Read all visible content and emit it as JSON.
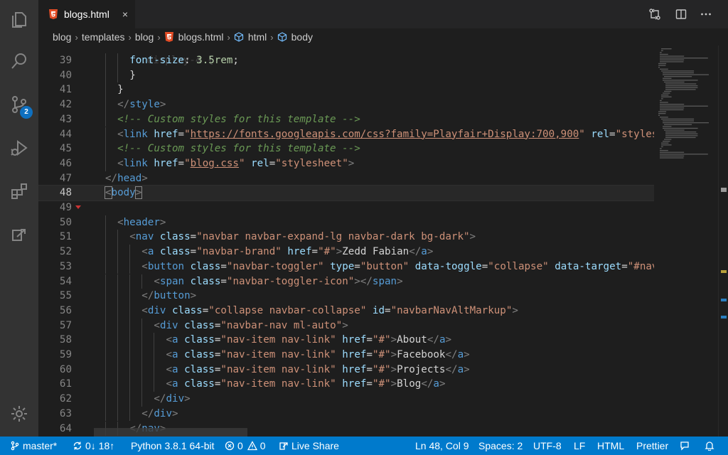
{
  "activity_bar": {
    "items": [
      {
        "name": "explorer-icon"
      },
      {
        "name": "search-icon"
      },
      {
        "name": "source-control-icon",
        "badge": "2"
      },
      {
        "name": "run-debug-icon"
      },
      {
        "name": "extensions-icon"
      },
      {
        "name": "live-share-icon"
      }
    ],
    "settings": {
      "name": "gear-icon"
    }
  },
  "tab": {
    "label": "blogs.html",
    "close": "×",
    "icon": "html5-icon"
  },
  "breadcrumb": [
    "blog",
    "templates",
    "blog",
    "blogs.html",
    "html",
    "body"
  ],
  "editor": {
    "current_line": "48",
    "lines": [
      {
        "n": "39",
        "indent": 2,
        "html": "<span class=\"p\">font-size</span>: <span class=\"num\">3.5rem</span>;"
      },
      {
        "n": "40",
        "indent": 2,
        "html": "}"
      },
      {
        "n": "41",
        "indent": 1,
        "html": "}"
      },
      {
        "n": "42",
        "indent": 1,
        "html": "<span class=\"t\">&lt;/</span><span class=\"n\">style</span><span class=\"t\">&gt;</span>"
      },
      {
        "n": "43",
        "indent": 1,
        "html": "<span class=\"c\">&lt;!-- Custom styles for this template --&gt;</span>"
      },
      {
        "n": "44",
        "indent": 1,
        "html": "<span class=\"t\">&lt;</span><span class=\"n\">link</span> <span class=\"a\">href</span>=<span class=\"s\">\"</span><span class=\"u\">https://fonts.googleapis.com/css?family=Playfair+Display:700,900</span><span class=\"s\">\"</span> <span class=\"a\">rel</span>=<span class=\"s\">\"styleshe</span>"
      },
      {
        "n": "45",
        "indent": 1,
        "html": "<span class=\"c\">&lt;!-- Custom styles for this template --&gt;</span>"
      },
      {
        "n": "46",
        "indent": 1,
        "html": "<span class=\"t\">&lt;</span><span class=\"n\">link</span> <span class=\"a\">href</span>=<span class=\"s\">\"</span><span class=\"u\">blog.css</span><span class=\"s\">\"</span> <span class=\"a\">rel</span>=<span class=\"s\">\"stylesheet\"</span><span class=\"t\">&gt;</span>"
      },
      {
        "n": "47",
        "indent": 0,
        "html": "<span class=\"t\">&lt;/</span><span class=\"n\">head</span><span class=\"t\">&gt;</span>"
      },
      {
        "n": "48",
        "indent": 0,
        "html": "<span class=\"t bracket\">&lt;</span><span class=\"n\">body</span><span class=\"t bracket\">&gt;</span>"
      },
      {
        "n": "49",
        "indent": 0,
        "html": ""
      },
      {
        "n": "50",
        "indent": 1,
        "html": "<span class=\"t\">&lt;</span><span class=\"n\">header</span><span class=\"t\">&gt;</span>"
      },
      {
        "n": "51",
        "indent": 2,
        "html": "<span class=\"t\">&lt;</span><span class=\"n\">nav</span> <span class=\"a\">class</span>=<span class=\"s\">\"navbar navbar-expand-lg navbar-dark bg-dark\"</span><span class=\"t\">&gt;</span>"
      },
      {
        "n": "52",
        "indent": 3,
        "html": "<span class=\"t\">&lt;</span><span class=\"n\">a</span> <span class=\"a\">class</span>=<span class=\"s\">\"navbar-brand\"</span> <span class=\"a\">href</span>=<span class=\"s\">\"#\"</span><span class=\"t\">&gt;</span>Zedd Fabian<span class=\"t\">&lt;/</span><span class=\"n\">a</span><span class=\"t\">&gt;</span>"
      },
      {
        "n": "53",
        "indent": 3,
        "html": "<span class=\"t\">&lt;</span><span class=\"n\">button</span> <span class=\"a\">class</span>=<span class=\"s\">\"navbar-toggler\"</span> <span class=\"a\">type</span>=<span class=\"s\">\"button\"</span> <span class=\"a\">data-toggle</span>=<span class=\"s\">\"collapse\"</span> <span class=\"a\">data-target</span>=<span class=\"s\">\"#navba</span>"
      },
      {
        "n": "54",
        "indent": 4,
        "html": "<span class=\"t\">&lt;</span><span class=\"n\">span</span> <span class=\"a\">class</span>=<span class=\"s\">\"navbar-toggler-icon\"</span><span class=\"t\">&gt;&lt;/</span><span class=\"n\">span</span><span class=\"t\">&gt;</span>"
      },
      {
        "n": "55",
        "indent": 3,
        "html": "<span class=\"t\">&lt;/</span><span class=\"n\">button</span><span class=\"t\">&gt;</span>"
      },
      {
        "n": "56",
        "indent": 3,
        "html": "<span class=\"t\">&lt;</span><span class=\"n\">div</span> <span class=\"a\">class</span>=<span class=\"s\">\"collapse navbar-collapse\"</span> <span class=\"a\">id</span>=<span class=\"s\">\"navbarNavAltMarkup\"</span><span class=\"t\">&gt;</span>"
      },
      {
        "n": "57",
        "indent": 4,
        "html": "<span class=\"t\">&lt;</span><span class=\"n\">div</span> <span class=\"a\">class</span>=<span class=\"s\">\"navbar-nav ml-auto\"</span><span class=\"t\">&gt;</span>"
      },
      {
        "n": "58",
        "indent": 5,
        "html": "<span class=\"t\">&lt;</span><span class=\"n\">a</span> <span class=\"a\">class</span>=<span class=\"s\">\"nav-item nav-link\"</span> <span class=\"a\">href</span>=<span class=\"s\">\"#\"</span><span class=\"t\">&gt;</span>About<span class=\"t\">&lt;/</span><span class=\"n\">a</span><span class=\"t\">&gt;</span>"
      },
      {
        "n": "59",
        "indent": 5,
        "html": "<span class=\"t\">&lt;</span><span class=\"n\">a</span> <span class=\"a\">class</span>=<span class=\"s\">\"nav-item nav-link\"</span> <span class=\"a\">href</span>=<span class=\"s\">\"#\"</span><span class=\"t\">&gt;</span>Facebook<span class=\"t\">&lt;/</span><span class=\"n\">a</span><span class=\"t\">&gt;</span>"
      },
      {
        "n": "60",
        "indent": 5,
        "html": "<span class=\"t\">&lt;</span><span class=\"n\">a</span> <span class=\"a\">class</span>=<span class=\"s\">\"nav-item nav-link\"</span> <span class=\"a\">href</span>=<span class=\"s\">\"#\"</span><span class=\"t\">&gt;</span>Projects<span class=\"t\">&lt;/</span><span class=\"n\">a</span><span class=\"t\">&gt;</span>"
      },
      {
        "n": "61",
        "indent": 5,
        "html": "<span class=\"t\">&lt;</span><span class=\"n\">a</span> <span class=\"a\">class</span>=<span class=\"s\">\"nav-item nav-link\"</span> <span class=\"a\">href</span>=<span class=\"s\">\"#\"</span><span class=\"t\">&gt;</span>Blog<span class=\"t\">&lt;/</span><span class=\"n\">a</span><span class=\"t\">&gt;</span>"
      },
      {
        "n": "62",
        "indent": 4,
        "html": "<span class=\"t\">&lt;/</span><span class=\"n\">div</span><span class=\"t\">&gt;</span>"
      },
      {
        "n": "63",
        "indent": 3,
        "html": "<span class=\"t\">&lt;/</span><span class=\"n\">div</span><span class=\"t\">&gt;</span>"
      },
      {
        "n": "64",
        "indent": 2,
        "html": "<span class=\"t\">&lt;/</span><span class=\"n\">nav</span><span class=\"t\">&gt;</span>"
      }
    ]
  },
  "status": {
    "branch": "master*",
    "sync": "0↓ 18↑",
    "python": "Python 3.8.1 64-bit",
    "errors": "0",
    "warnings": "0",
    "live_share": "Live Share",
    "position": "Ln 48, Col 9",
    "spaces": "Spaces: 2",
    "encoding": "UTF-8",
    "eol": "LF",
    "language": "HTML",
    "formatter": "Prettier"
  },
  "colors": {
    "accent": "#007acc",
    "badge": "#0e70c0",
    "background": "#1e1e1e"
  }
}
